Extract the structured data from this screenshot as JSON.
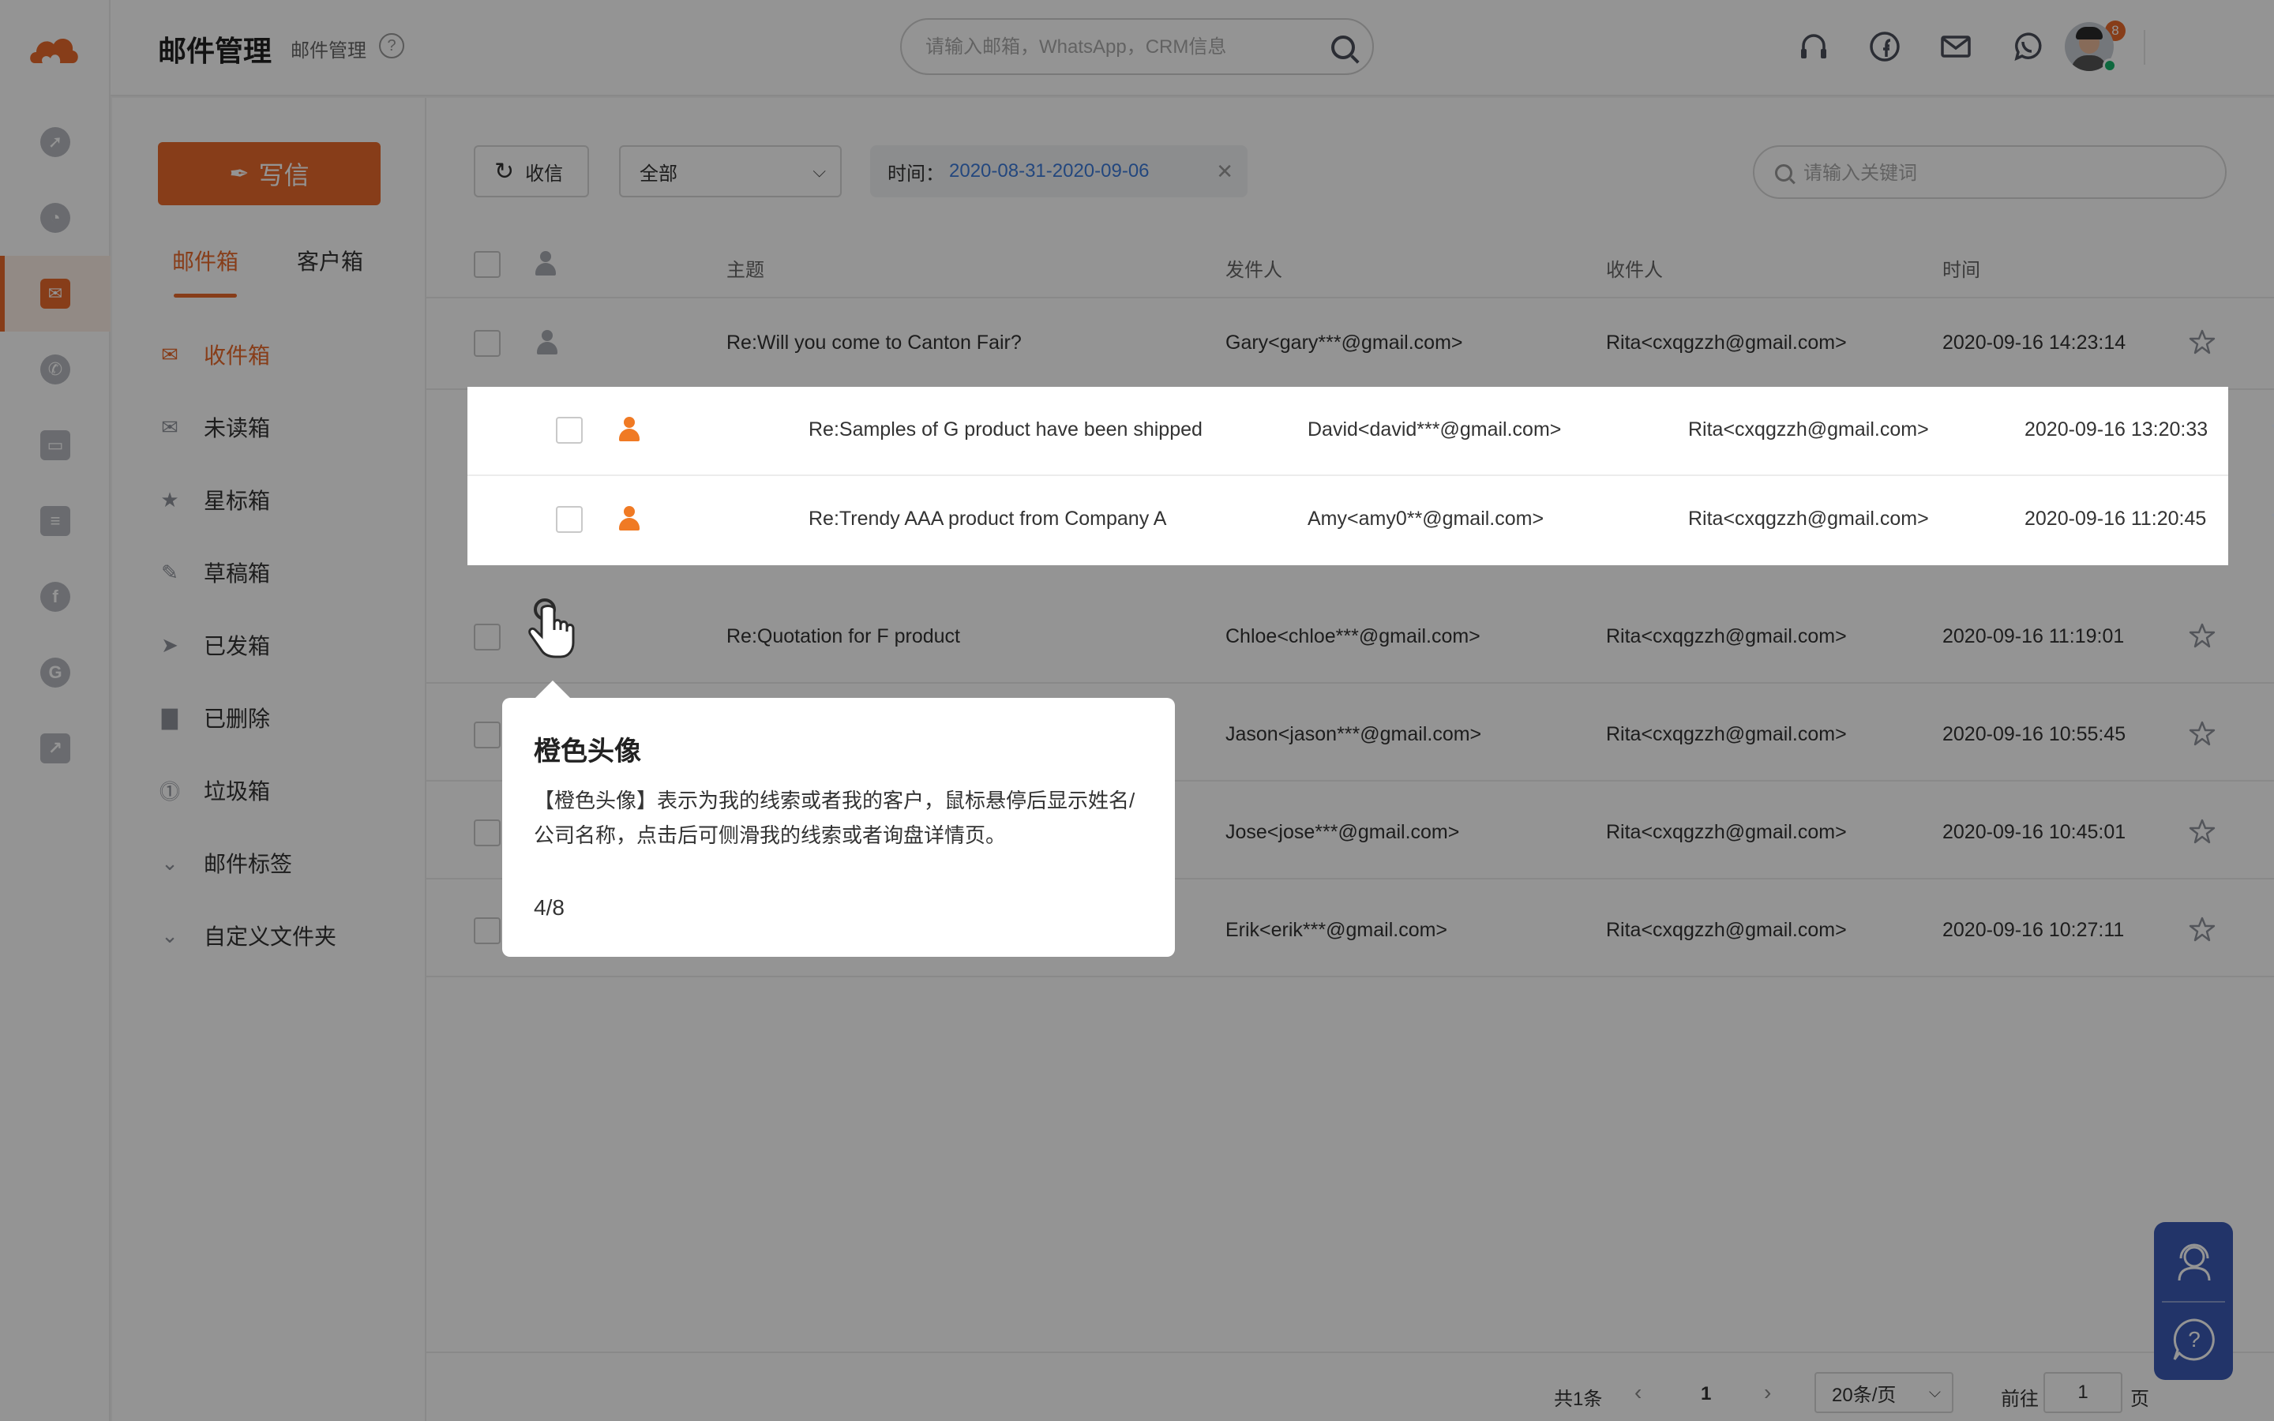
{
  "header": {
    "title": "邮件管理",
    "breadcrumb": "邮件管理",
    "search_placeholder": "请输入邮箱，WhatsApp，CRM信息",
    "apps_badge": "8"
  },
  "sidebar": {
    "compose_label": "写信",
    "tabs": [
      "邮件箱",
      "客户箱"
    ],
    "folders": [
      "收件箱",
      "未读箱",
      "星标箱",
      "草稿箱",
      "已发箱",
      "已删除",
      "垃圾箱",
      "邮件标签",
      "自定义文件夹"
    ]
  },
  "toolbar": {
    "refresh_label": "收信",
    "filter_value": "全部",
    "time_label": "时间：",
    "time_value": "2020-08-31-2020-09-06",
    "keyword_placeholder": "请输入关键词"
  },
  "table": {
    "columns": [
      "主题",
      "发件人",
      "收件人",
      "时间"
    ],
    "rows": [
      {
        "subject": "Re:Will you come to Canton Fair?",
        "sender": "Gary<gary***@gmail.com>",
        "recipient": "Rita<cxqgzzh@gmail.com>",
        "time": "2020-09-16 14:23:14",
        "avatar": "grey"
      },
      {
        "subject": "Re:Samples of G product have been shipped",
        "sender": "David<david***@gmail.com>",
        "recipient": "Rita<cxqgzzh@gmail.com>",
        "time": "2020-09-16 13:20:33",
        "avatar": "orange"
      },
      {
        "subject": "Re:Trendy AAA product from Company A",
        "sender": "Amy<amy0**@gmail.com>",
        "recipient": "Rita<cxqgzzh@gmail.com>",
        "time": "2020-09-16 11:20:45",
        "avatar": "orange"
      },
      {
        "subject": "Re:Quotation for F product",
        "sender": "Chloe<chloe***@gmail.com>",
        "recipient": "Rita<cxqgzzh@gmail.com>",
        "time": "2020-09-16 11:19:01",
        "avatar": "grey"
      },
      {
        "subject": "",
        "sender": "Jason<jason***@gmail.com>",
        "recipient": "Rita<cxqgzzh@gmail.com>",
        "time": "2020-09-16 10:55:45",
        "avatar": "grey"
      },
      {
        "subject": "",
        "sender": "Jose<jose***@gmail.com>",
        "recipient": "Rita<cxqgzzh@gmail.com>",
        "time": "2020-09-16 10:45:01",
        "avatar": "grey"
      },
      {
        "subject": "",
        "sender": "Erik<erik***@gmail.com>",
        "recipient": "Rita<cxqgzzh@gmail.com>",
        "time": "2020-09-16 10:27:11",
        "avatar": "grey"
      }
    ]
  },
  "tooltip": {
    "title": "橙色头像",
    "description": "【橙色头像】表示为我的线索或者我的客户，鼠标悬停后显示姓名/公司名称，点击后可侧滑我的线索或者询盘详情页。",
    "step": "4/8"
  },
  "pagination": {
    "total": "共1条",
    "current_page": "1",
    "page_size": "20条/页",
    "goto_label": "前往",
    "goto_value": "1",
    "page_suffix": "页"
  },
  "colors": {
    "accent": "#e8692b",
    "link": "#3d7bd9",
    "help_widget": "#3b5bb5"
  }
}
